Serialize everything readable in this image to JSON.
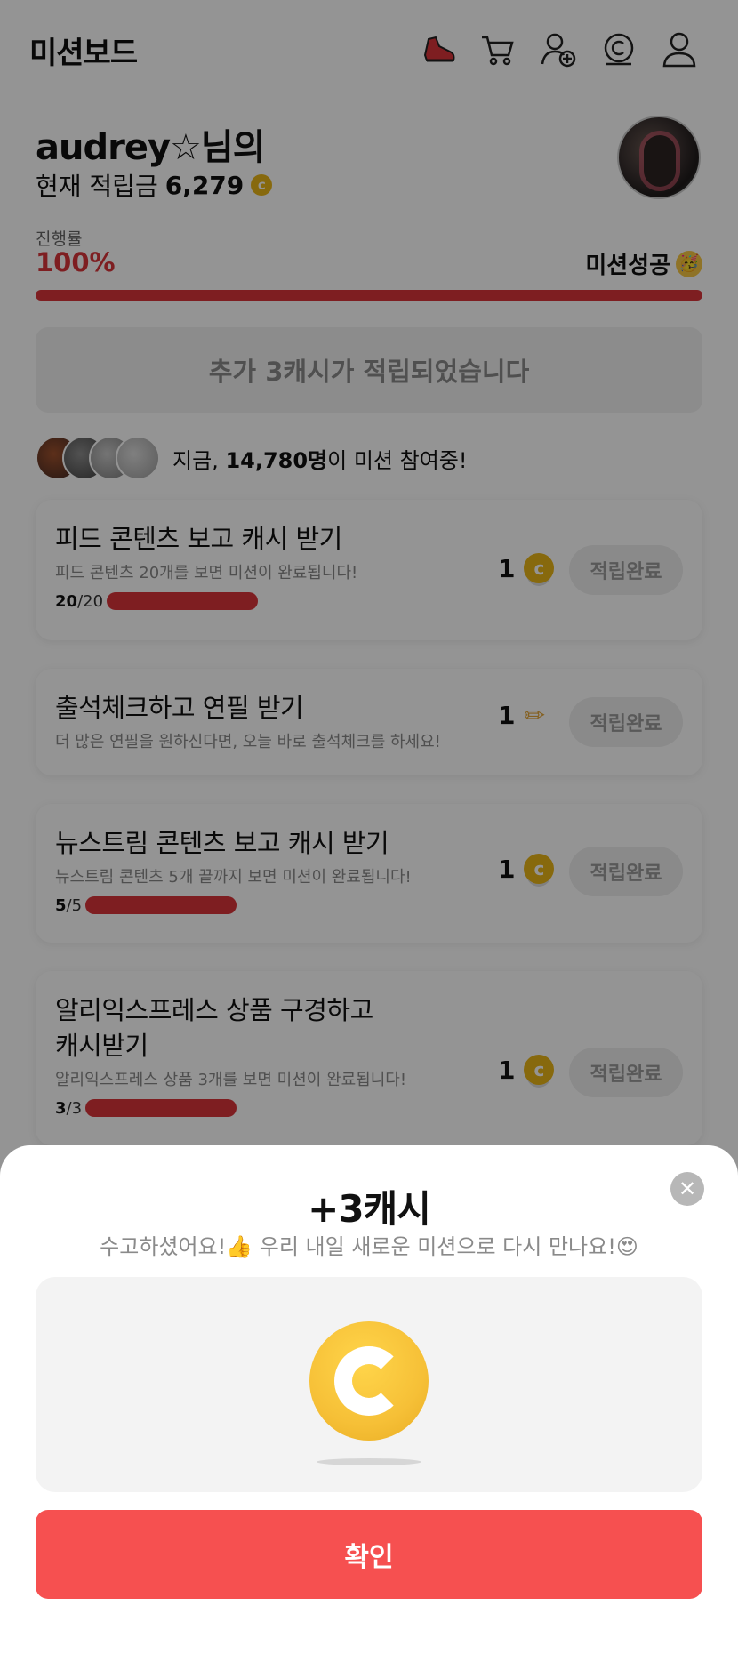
{
  "header": {
    "title": "미션보드",
    "icons": [
      "sneaker-icon",
      "cart-icon",
      "add-friend-icon",
      "cash-icon",
      "profile-icon"
    ]
  },
  "profile": {
    "greeting": "audrey☆님의",
    "balance_label": "현재 적립금",
    "balance_value": "6,279",
    "coin_symbol": "c"
  },
  "progress": {
    "label": "진행률",
    "value_text": "100%",
    "fraction": 1.0,
    "status": "미션성공",
    "status_emoji": "🥳"
  },
  "notice": "추가 3캐시가 적립되었습니다",
  "participants": {
    "prefix": "지금,",
    "count": "14,780명",
    "suffix": "이 미션 참여중!"
  },
  "missions": [
    {
      "title": "피드 콘텐츠 보고 캐시 받기",
      "desc": "피드 콘텐츠 20개를 보면 미션이 완료됩니다!",
      "done": "20",
      "total": "/20",
      "reward": "1",
      "reward_icon": "coin-icon",
      "button": "적립완료",
      "progress": 1.0
    },
    {
      "title": "출석체크하고 연필 받기",
      "desc": "더 많은 연필을 원하신다면, 오늘 바로 출석체크를 하세요!",
      "reward": "1",
      "reward_icon": "pencil-icon",
      "reward_glyph": "✏",
      "button": "적립완료"
    },
    {
      "title": "뉴스트림 콘텐츠 보고 캐시 받기",
      "desc": "뉴스트림 콘텐츠 5개 끝까지 보면 미션이 완료됩니다!",
      "done": "5",
      "total": "/5",
      "reward": "1",
      "reward_icon": "coin-icon",
      "button": "적립완료",
      "progress": 1.0
    },
    {
      "title_line1": "알리익스프레스 상품 구경하고",
      "title_line2": "캐시받기",
      "desc": "알리익스프레스 상품 3개를 보면 미션이 완료됩니다!",
      "done": "3",
      "total": "/3",
      "reward": "1",
      "reward_icon": "coin-icon",
      "button": "적립완료",
      "progress": 1.0
    }
  ],
  "sheet": {
    "title": "+3캐시",
    "subtitle": "수고하셨어요!👍 우리 내일 새로운 미션으로 다시 만나요!😍",
    "confirm": "확인",
    "close_glyph": "✕"
  },
  "colors": {
    "accent_red": "#d9343a",
    "confirm_button": "#f65050",
    "coin_gold": "#e9b517"
  }
}
